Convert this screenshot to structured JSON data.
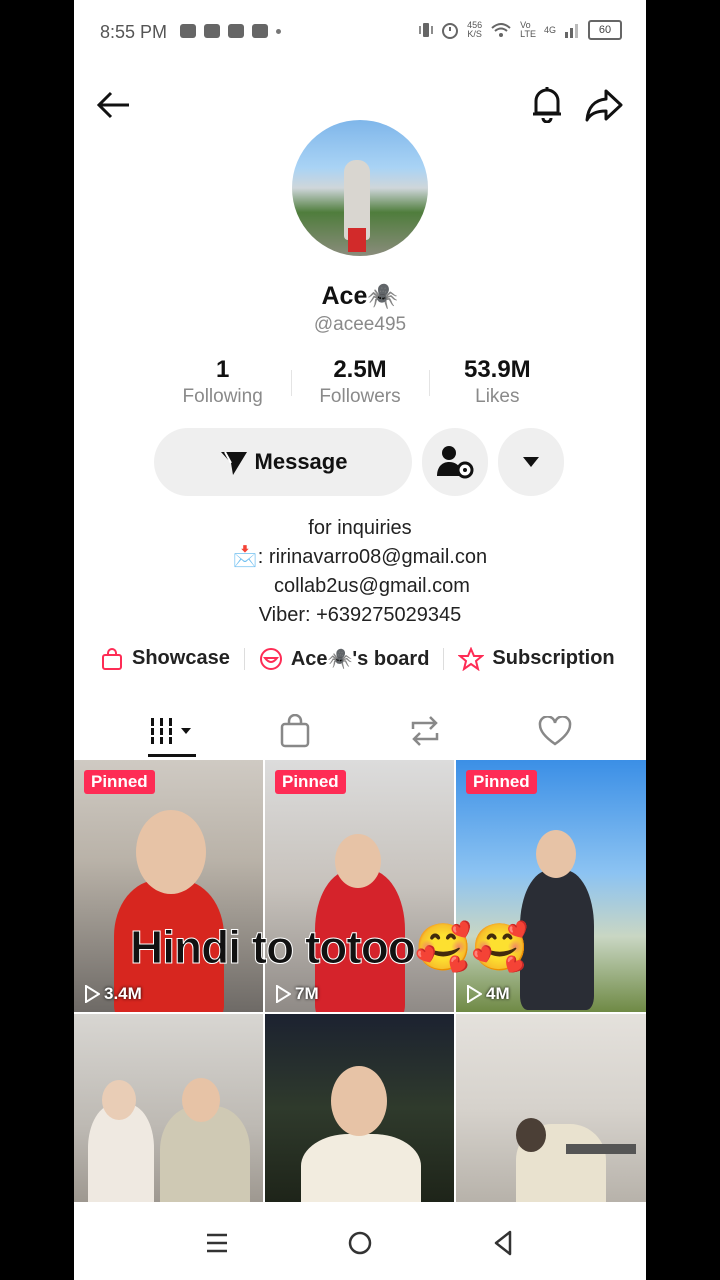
{
  "status": {
    "time": "8:55 PM",
    "net_speed_top": "456",
    "net_speed_bottom": "K/S",
    "volte_top": "Vo",
    "volte_bottom": "LTE",
    "network": "4G",
    "battery": "60"
  },
  "profile": {
    "name": "Ace🕷️",
    "handle": "@acee495",
    "stats": [
      {
        "value": "1",
        "label": "Following"
      },
      {
        "value": "2.5M",
        "label": "Followers"
      },
      {
        "value": "53.9M",
        "label": "Likes"
      }
    ],
    "message_label": "Message",
    "bio": [
      "for inquiries",
      "📩: ririnavarro08@gmail.con",
      "collab2us@gmail.com",
      "Viber: +639275029345"
    ],
    "links": [
      {
        "label": "Showcase"
      },
      {
        "label": "Ace🕷️'s board"
      },
      {
        "label": "Subscription"
      }
    ]
  },
  "videos": [
    {
      "pinned": "Pinned",
      "views": "3.4M"
    },
    {
      "pinned": "Pinned",
      "views": "7M"
    },
    {
      "pinned": "Pinned",
      "views": "4M"
    },
    {},
    {},
    {}
  ],
  "overlay_caption": "Hindi to totoo🥰🥰",
  "colors": {
    "accent": "#fe2c55",
    "link_icon": "#fe2c55"
  }
}
